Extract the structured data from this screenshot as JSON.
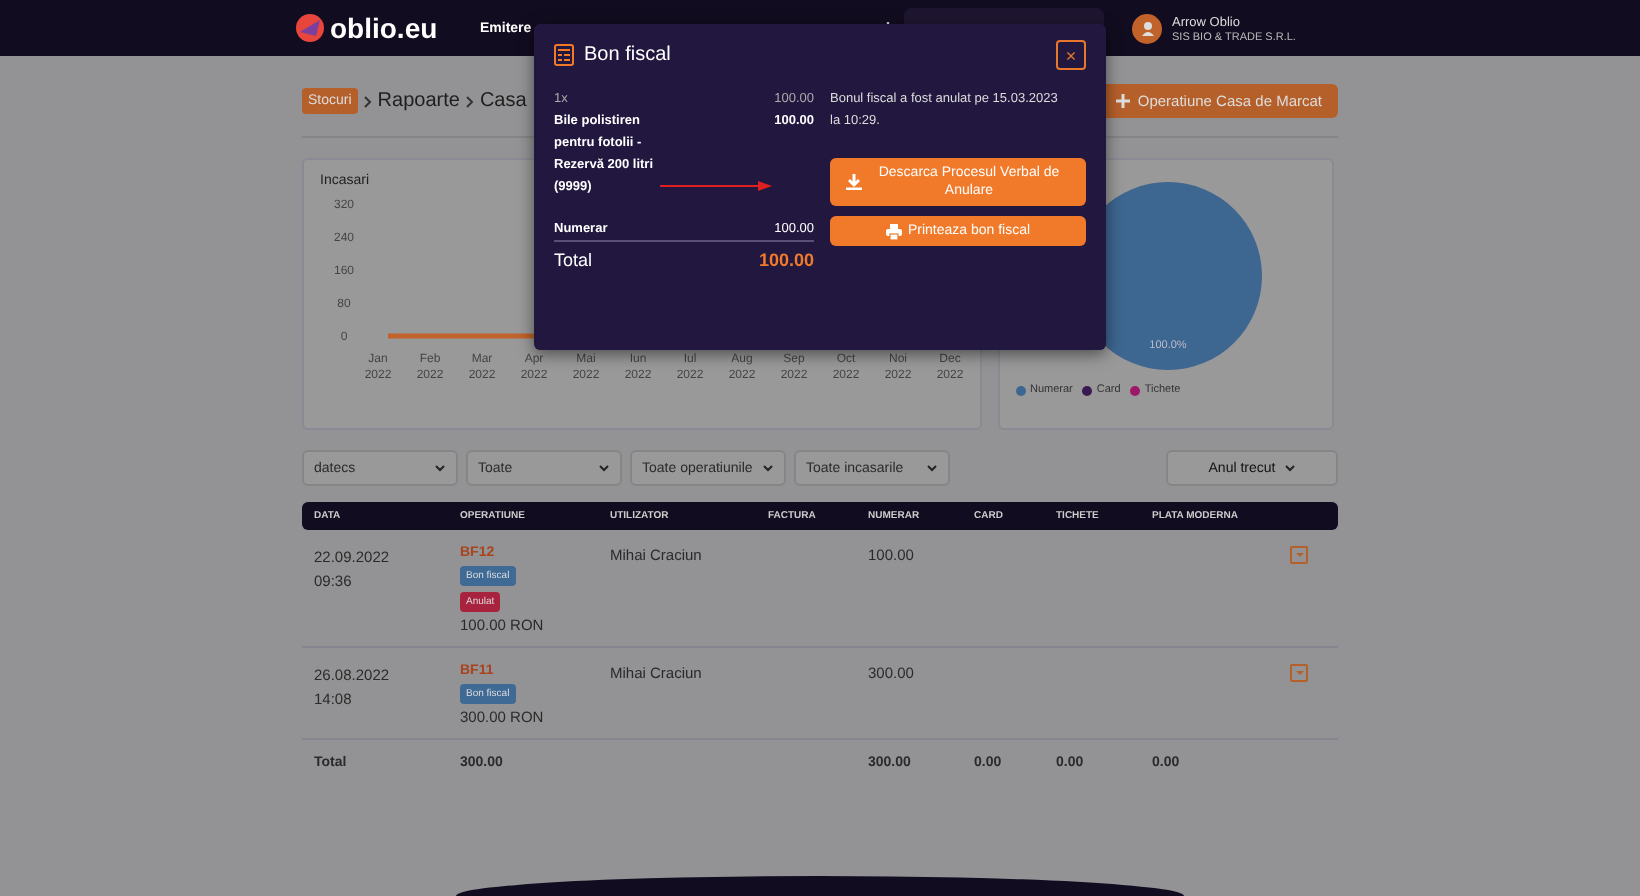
{
  "header": {
    "logo": "oblio.eu",
    "nav": [
      {
        "label": "Emitere",
        "selected": true
      }
    ],
    "user": {
      "name": "Arrow Oblio",
      "company": "SIS BIO & TRADE S.R.L."
    }
  },
  "breadcrumb": [
    {
      "label": "Stocuri",
      "kind": "badge"
    },
    {
      "label": "Rapoarte",
      "kind": "link"
    },
    {
      "label": "Casa",
      "kind": "link"
    }
  ],
  "add_button": {
    "label": "Operatiune Casa de Marcat"
  },
  "revenue_chart": {
    "chart_data": {
      "type": "line",
      "title": "Incasari",
      "categories": [
        "Jan 2022",
        "Feb 2022",
        "Mar 2022",
        "Apr 2022",
        "Mai 2022",
        "Iun 2022",
        "Iul 2022",
        "Aug 2022",
        "Sep 2022",
        "Oct 2022",
        "Noi 2022",
        "Dec 2022"
      ],
      "yticks": [
        0,
        80,
        160,
        240,
        320
      ],
      "ylim": [
        0,
        320
      ],
      "series": [
        {
          "color": "#c0622a",
          "values": [
            0,
            0,
            0,
            0,
            null,
            null,
            null,
            null,
            null,
            null,
            null,
            null
          ]
        }
      ]
    }
  },
  "payment_chart": {
    "chart_data": {
      "type": "pie",
      "categories": [
        "Numerar",
        "Card",
        "Tichete"
      ],
      "values": [
        100,
        0,
        0
      ],
      "value_labels": [
        "100.0%",
        null,
        null
      ]
    },
    "legend": [
      {
        "color": "#3d6690"
      },
      {
        "color": "#3a1a52"
      },
      {
        "color": "#9c1868"
      }
    ]
  },
  "filters": [
    {
      "value": "datecs",
      "kind": "select"
    },
    {
      "value": "Toate",
      "kind": "select"
    },
    {
      "value": "Toate operatiunile",
      "kind": "select"
    },
    {
      "value": "Toate incasarile",
      "kind": "select"
    },
    {
      "value": "Anul trecut",
      "kind": "dropdown"
    }
  ],
  "table": {
    "columns": [
      "DATA",
      "OPERATIUNE",
      "UTILIZATOR",
      "FACTURA",
      "NUMERAR",
      "CARD",
      "TICHETE",
      "PLATA MODERNA"
    ],
    "rows": [
      {
        "date": "22.09.2022",
        "time": "09:36",
        "number": "BF12",
        "tags": [
          {
            "label": "Bon fiscal",
            "color": "#3f6a96"
          },
          {
            "label": "Anulat",
            "color": "#a8233e"
          }
        ],
        "amount": "100.00 RON",
        "user": "Mihai Craciun",
        "cash": "100.00"
      },
      {
        "date": "26.08.2022",
        "time": "14:08",
        "number": "BF11",
        "tags": [
          {
            "label": "Bon fiscal",
            "color": "#3f6a96"
          }
        ],
        "amount": "300.00 RON",
        "user": "Mihai Craciun",
        "cash": "300.00"
      }
    ],
    "totals": {
      "label": "Total",
      "operation": "300.00",
      "cash": "300.00",
      "card": "0.00",
      "vouchers": "0.00",
      "modern": "0.00"
    }
  },
  "modal": {
    "title": "Bon fiscal",
    "close": "×",
    "items": [
      {
        "qty": "1x",
        "unit_price": "100.00",
        "name": "Bile polistiren pentru fotolii - Rezervă 200 litri (9999)",
        "total": "100.00"
      }
    ],
    "payments": [
      {
        "label": "Numerar",
        "amount": "100.00"
      }
    ],
    "total": {
      "label": "Total",
      "amount": "100.00"
    },
    "message": "Bonul fiscal a fost anulat pe 15.03.2023 la 10:29.",
    "buttons": [
      {
        "label": "Descarca Procesul Verbal de Anulare"
      },
      {
        "label": "Printeaza bon fiscal"
      }
    ]
  }
}
